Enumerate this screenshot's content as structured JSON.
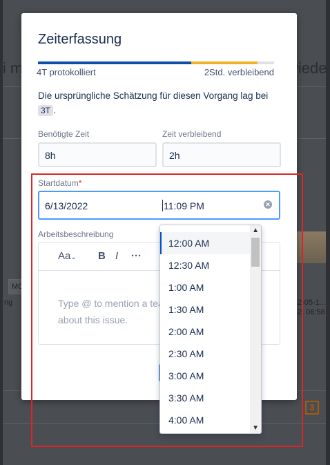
{
  "background": {
    "heading_left": "i m",
    "heading_right": "wiede",
    "mo_label": "MC",
    "left_text": "ng",
    "right_text_1": "2-05-1...",
    "right_text_2": "2, 06:58",
    "badge": "3"
  },
  "dialog": {
    "title": "Zeiterfassung",
    "logged": "4T protokolliert",
    "remaining": "2Std. verbleibend",
    "progress": 0.65,
    "estimate_text": "Die ursprüngliche Schätzung für diesen Vorgang lag bei",
    "estimate_value": "3T",
    "time_spent_label": "Benötigte Zeit",
    "time_spent_value": "8h",
    "time_remaining_label": "Zeit verbleibend",
    "time_remaining_value": "2h",
    "start_date_label": "Startdatum",
    "required_marker": "*",
    "start_date_value": "6/13/2022",
    "start_time_value": "11:09 PM",
    "description_label": "Arbeitsbeschreibung",
    "toolbar": {
      "text_style": "Aa",
      "bold": "B",
      "italic": "I",
      "more": "···"
    },
    "description_placeholder_line1": "Type @ to mention a tea",
    "description_placeholder_line2": "about this issue.",
    "cancel_label": "hen"
  },
  "time_dropdown": {
    "options": [
      "12:00 AM",
      "12:30 AM",
      "1:00 AM",
      "1:30 AM",
      "2:00 AM",
      "2:30 AM",
      "3:00 AM",
      "3:30 AM",
      "4:00 AM"
    ],
    "selected_index": 0
  },
  "colors": {
    "progress_logged": "#0b4fa8",
    "progress_remaining": "#f2b227",
    "focus": "#4c9aff",
    "highlight": "#e02424"
  }
}
